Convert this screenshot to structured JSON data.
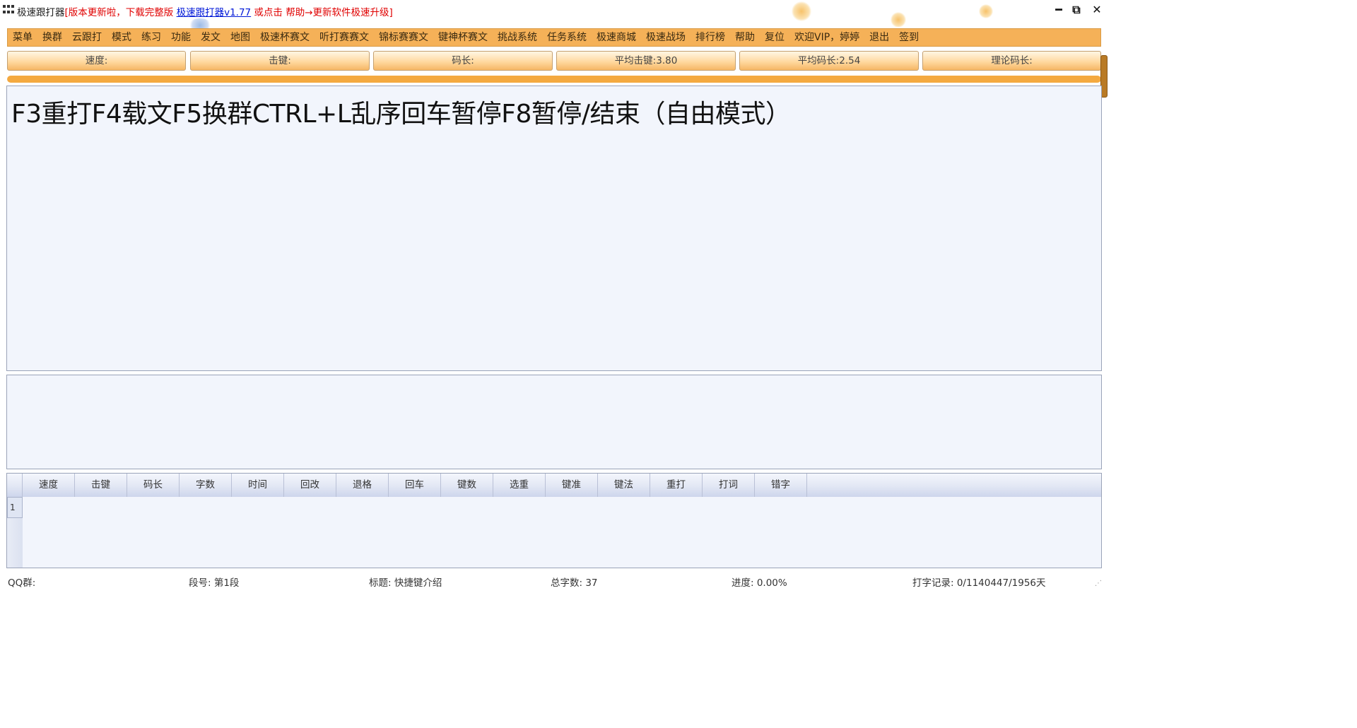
{
  "titlebar": {
    "app_name": "极速跟打器",
    "bracket_open": "[",
    "notice": "版本更新啦，下载完整版 ",
    "link_text": "极速跟打器v1.77",
    "notice_tail": " 或点击 帮助→更新软件极速升级",
    "bracket_close": "]",
    "minimize": "━",
    "restore": "⧉",
    "close": "✕"
  },
  "menu": {
    "items": [
      "菜单",
      "换群",
      "云跟打",
      "模式",
      "练习",
      "功能",
      "发文",
      "地图",
      "极速杯赛文",
      "听打赛赛文",
      "锦标赛赛文",
      "键神杯赛文",
      "挑战系统",
      "任务系统",
      "极速商城",
      "极速战场",
      "排行榜",
      "帮助",
      "复位",
      "欢迎VIP，婷婷",
      "退出",
      "签到"
    ]
  },
  "stats": {
    "speed": "速度:",
    "keystroke": "击键:",
    "code_length": "码长:",
    "avg_keystroke": "平均击键:3.80",
    "avg_code_length": "平均码长:2.54",
    "theory_code_length": "理论码长:"
  },
  "progress": {
    "fraction": 1.0
  },
  "article": {
    "text": "F3重打F4载文F5换群CTRL+L乱序回车暂停F8暂停/结束（自由模式）"
  },
  "input": {
    "value": ""
  },
  "results": {
    "columns": [
      "速度",
      "击键",
      "码长",
      "字数",
      "时间",
      "回改",
      "退格",
      "回车",
      "键数",
      "选重",
      "键准",
      "键法",
      "重打",
      "打词",
      "错字"
    ],
    "row_numbers": [
      "1"
    ]
  },
  "status": {
    "qq_group": "QQ群:",
    "segment": "段号: 第1段",
    "title": "标题: 快捷键介绍",
    "total_chars": "总字数: 37",
    "progress": "进度: 0.00%",
    "record": "打字记录: 0/1140447/1956天"
  },
  "colors": {
    "menu_bg": "#f5b158",
    "accent_orange": "#f4a940",
    "title_red": "#e00000",
    "link_blue": "#0018d8",
    "panel_bg": "#f2f5fc"
  }
}
